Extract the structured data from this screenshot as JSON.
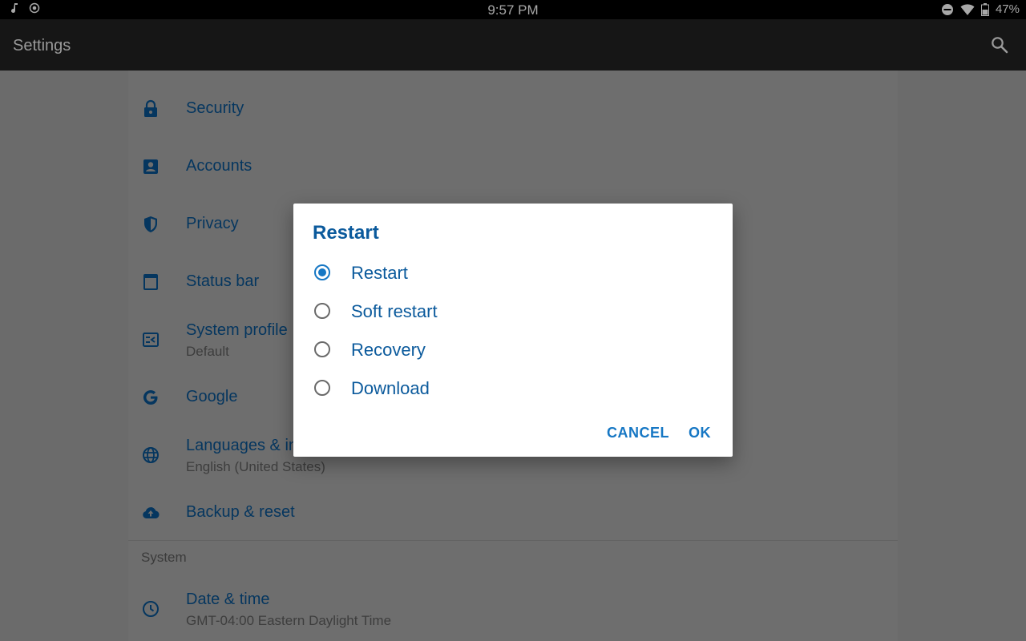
{
  "status_bar": {
    "time": "9:57 PM",
    "battery": "47%"
  },
  "app_bar": {
    "title": "Settings"
  },
  "settings": {
    "partial_row_label": "",
    "items": [
      {
        "icon": "lock-icon",
        "title": "Security"
      },
      {
        "icon": "account-box-icon",
        "title": "Accounts"
      },
      {
        "icon": "shield-icon",
        "title": "Privacy"
      },
      {
        "icon": "status-bar-icon",
        "title": "Status bar"
      },
      {
        "icon": "system-profile-icon",
        "title": "System profile",
        "subtitle": "Default"
      },
      {
        "icon": "google-icon",
        "title": "Google"
      },
      {
        "icon": "globe-icon",
        "title": "Languages & input",
        "subtitle": "English (United States)"
      },
      {
        "icon": "cloud-upload-icon",
        "title": "Backup & reset"
      }
    ],
    "section_system": "System",
    "system_items": [
      {
        "icon": "clock-icon",
        "title": "Date & time",
        "subtitle": "GMT-04:00 Eastern Daylight Time"
      }
    ]
  },
  "dialog": {
    "title": "Restart",
    "options": [
      {
        "label": "Restart",
        "selected": true
      },
      {
        "label": "Soft restart",
        "selected": false
      },
      {
        "label": "Recovery",
        "selected": false
      },
      {
        "label": "Download",
        "selected": false
      }
    ],
    "cancel_label": "CANCEL",
    "ok_label": "OK"
  },
  "colors": {
    "accent": "#1677c4",
    "dialog_text": "#0b5a9c",
    "scrim_background": "#6b6b6b",
    "item_text_dimmed": "#05365f"
  }
}
